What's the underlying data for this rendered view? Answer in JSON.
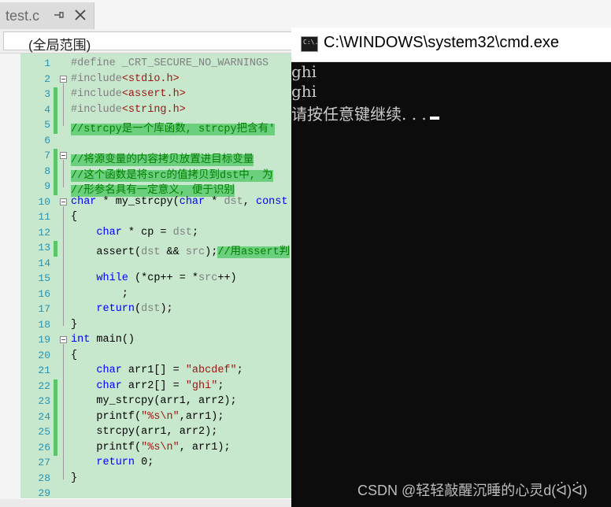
{
  "tab": {
    "title": "test.c",
    "pin_icon": "pin-icon",
    "close_icon": "close-icon"
  },
  "scope": {
    "label": "(全局范围)"
  },
  "editor": {
    "lines": [
      {
        "n": "1",
        "chg": "",
        "code": [
          [
            "pp",
            "#define _CRT_SECURE_NO_WARNINGS"
          ]
        ]
      },
      {
        "n": "2",
        "chg": "",
        "fold": true,
        "code": [
          [
            "pp",
            "#include"
          ],
          [
            "inc",
            "<stdio.h>"
          ]
        ]
      },
      {
        "n": "3",
        "chg": "g",
        "code": [
          [
            "pp",
            "#include"
          ],
          [
            "inc",
            "<assert.h>"
          ]
        ]
      },
      {
        "n": "4",
        "chg": "g",
        "code": [
          [
            "pp",
            "#include"
          ],
          [
            "inc",
            "<string.h>"
          ]
        ]
      },
      {
        "n": "5",
        "chg": "g",
        "code": [
          [
            "cm",
            "//strcpy是一个库函数, strcpy把含有'"
          ]
        ]
      },
      {
        "n": "6",
        "chg": "",
        "code": []
      },
      {
        "n": "7",
        "chg": "g",
        "fold": true,
        "code": [
          [
            "cm",
            "//将源变量的内容拷贝放置进目标变量"
          ]
        ]
      },
      {
        "n": "8",
        "chg": "g",
        "code": [
          [
            "cm",
            "//这个函数是将src的值拷贝到dst中, 为"
          ]
        ]
      },
      {
        "n": "9",
        "chg": "g",
        "code": [
          [
            "cm",
            "//形参名具有一定意义, 便于识别"
          ]
        ]
      },
      {
        "n": "10",
        "chg": "",
        "fold": true,
        "code": [
          [
            "kw",
            "char"
          ],
          [
            "",
            " * my_strcpy("
          ],
          [
            "kw",
            "char"
          ],
          [
            "",
            " * "
          ],
          [
            "prm",
            "dst"
          ],
          [
            "",
            ", "
          ],
          [
            "kw",
            "const"
          ]
        ]
      },
      {
        "n": "11",
        "chg": "",
        "code": [
          [
            "",
            "{"
          ]
        ]
      },
      {
        "n": "12",
        "chg": "",
        "code": [
          [
            "",
            "    "
          ],
          [
            "kw",
            "char"
          ],
          [
            "",
            " * cp = "
          ],
          [
            "prm",
            "dst"
          ],
          [
            "",
            ";"
          ]
        ]
      },
      {
        "n": "13",
        "chg": "g",
        "code": [
          [
            "",
            "    assert("
          ],
          [
            "prm",
            "dst"
          ],
          [
            "",
            " && "
          ],
          [
            "prm",
            "src"
          ],
          [
            "",
            ");"
          ],
          [
            "cm",
            "//用assert判"
          ]
        ]
      },
      {
        "n": "14",
        "chg": "",
        "code": []
      },
      {
        "n": "15",
        "chg": "",
        "code": [
          [
            "",
            "    "
          ],
          [
            "kw",
            "while"
          ],
          [
            "",
            " (*cp++ = *"
          ],
          [
            "prm",
            "src"
          ],
          [
            "",
            "++)"
          ]
        ]
      },
      {
        "n": "16",
        "chg": "",
        "code": [
          [
            "",
            "        ;"
          ]
        ]
      },
      {
        "n": "17",
        "chg": "",
        "code": [
          [
            "",
            "    "
          ],
          [
            "kw",
            "return"
          ],
          [
            "",
            "("
          ],
          [
            "prm",
            "dst"
          ],
          [
            "",
            ");"
          ]
        ]
      },
      {
        "n": "18",
        "chg": "",
        "code": [
          [
            "",
            "}"
          ]
        ]
      },
      {
        "n": "19",
        "chg": "",
        "fold": true,
        "code": [
          [
            "kw",
            "int"
          ],
          [
            "",
            " main()"
          ]
        ]
      },
      {
        "n": "20",
        "chg": "",
        "code": [
          [
            "",
            "{"
          ]
        ]
      },
      {
        "n": "21",
        "chg": "",
        "code": [
          [
            "",
            "    "
          ],
          [
            "kw",
            "char"
          ],
          [
            "",
            " arr1[] = "
          ],
          [
            "str",
            "\"abcdef\""
          ],
          [
            "",
            ";"
          ]
        ]
      },
      {
        "n": "22",
        "chg": "g",
        "code": [
          [
            "",
            "    "
          ],
          [
            "kw",
            "char"
          ],
          [
            "",
            " arr2[] = "
          ],
          [
            "str",
            "\"ghi\""
          ],
          [
            "",
            ";"
          ]
        ]
      },
      {
        "n": "23",
        "chg": "g",
        "code": [
          [
            "",
            "    my_strcpy(arr1, arr2);"
          ]
        ]
      },
      {
        "n": "24",
        "chg": "g",
        "code": [
          [
            "",
            "    printf("
          ],
          [
            "str",
            "\"%s\\n\""
          ],
          [
            "",
            ",arr1);"
          ]
        ]
      },
      {
        "n": "25",
        "chg": "g",
        "code": [
          [
            "",
            "    strcpy(arr1, arr2);"
          ]
        ]
      },
      {
        "n": "26",
        "chg": "g",
        "code": [
          [
            "",
            "    printf("
          ],
          [
            "str",
            "\"%s\\n\""
          ],
          [
            "",
            ", arr1);"
          ]
        ]
      },
      {
        "n": "27",
        "chg": "",
        "code": [
          [
            "",
            "    "
          ],
          [
            "kw",
            "return"
          ],
          [
            "",
            " 0;"
          ]
        ]
      },
      {
        "n": "28",
        "chg": "",
        "code": [
          [
            "",
            "}"
          ]
        ]
      },
      {
        "n": "29",
        "chg": "",
        "code": []
      }
    ]
  },
  "console": {
    "title": "C:\\WINDOWS\\system32\\cmd.exe",
    "icon_text": "C:\\.",
    "lines": [
      "ghi",
      "ghi",
      "请按任意键继续. . ."
    ],
    "watermark": "CSDN @轻轻敲醒沉睡的心灵d(ᐛ)ᐛ)"
  },
  "colors": {
    "change_saved": "#5cc46a",
    "highlight": "#c7e8cc",
    "console_bg": "#0c0c0c"
  }
}
